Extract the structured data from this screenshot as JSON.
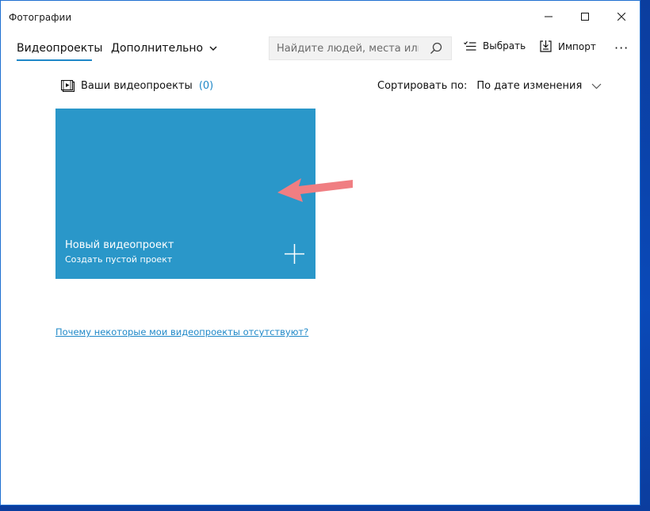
{
  "window": {
    "title": "Фотографии"
  },
  "toolbar": {
    "tab_active": "Видеопроекты",
    "tab_more": "Дополнительно",
    "search_placeholder": "Найдите людей, места или",
    "select_label": "Выбрать",
    "import_label": "Импорт",
    "more_label": "···"
  },
  "projects": {
    "header_label": "Ваши видеопроекты",
    "count": "(0)",
    "sort_label": "Сортировать по:",
    "sort_value": "По дате изменения"
  },
  "tile": {
    "title": "Новый видеопроект",
    "subtitle": "Создать пустой проект"
  },
  "help": {
    "link_text": "Почему некоторые мои видеопроекты отсутствуют?"
  },
  "colors": {
    "accent": "#1f88c8",
    "tile": "#2a97c9",
    "arrow": "#f07e82"
  },
  "icons": {
    "search": "search-icon",
    "select": "select-icon",
    "import": "import-icon",
    "video_project": "video-project-icon",
    "add": "plus-icon",
    "annotation": "annotation-arrow-icon"
  }
}
